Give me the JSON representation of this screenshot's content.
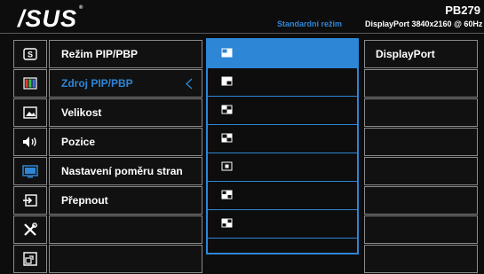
{
  "header": {
    "logo": "/SUS",
    "logo_mark": "®",
    "model": "PB279",
    "mode": "Standardní režim",
    "signal": "DisplayPort  3840x2160 @ 60Hz"
  },
  "sidebar": {
    "icons": [
      {
        "name": "splendid-icon",
        "selected": false
      },
      {
        "name": "color-icon",
        "selected": false
      },
      {
        "name": "image-icon",
        "selected": false
      },
      {
        "name": "sound-icon",
        "selected": false
      },
      {
        "name": "pip-pbp-icon",
        "selected": true
      },
      {
        "name": "input-select-icon",
        "selected": false
      },
      {
        "name": "system-setup-icon",
        "selected": false
      },
      {
        "name": "shortcut-icon",
        "selected": false
      }
    ]
  },
  "menu": {
    "items": [
      {
        "label": "Režim PIP/PBP"
      },
      {
        "label": "Zdroj PIP/PBP"
      },
      {
        "label": "Velikost"
      },
      {
        "label": "Pozice"
      },
      {
        "label": "Nastavení poměru stran"
      },
      {
        "label": "Přepnout"
      },
      {
        "label": ""
      },
      {
        "label": ""
      }
    ],
    "selected_index": 1
  },
  "options": {
    "items": [
      {
        "icon": "layout-pip-top-left-icon"
      },
      {
        "icon": "layout-pip-bottom-right-icon"
      },
      {
        "icon": "layout-split-horizontal-icon"
      },
      {
        "icon": "layout-split-vertical-icon"
      },
      {
        "icon": "layout-center-icon"
      },
      {
        "icon": "layout-quad-icon"
      },
      {
        "icon": "layout-quad-alt-icon"
      },
      {
        "icon": ""
      }
    ],
    "selected_index": 0
  },
  "values": {
    "items": [
      {
        "label": "DisplayPort"
      },
      {
        "label": ""
      },
      {
        "label": ""
      },
      {
        "label": ""
      },
      {
        "label": ""
      },
      {
        "label": ""
      },
      {
        "label": ""
      },
      {
        "label": ""
      }
    ]
  },
  "colors": {
    "accent": "#2e86d6",
    "background": "#0d0d0d",
    "border": "#8a8a8a"
  }
}
